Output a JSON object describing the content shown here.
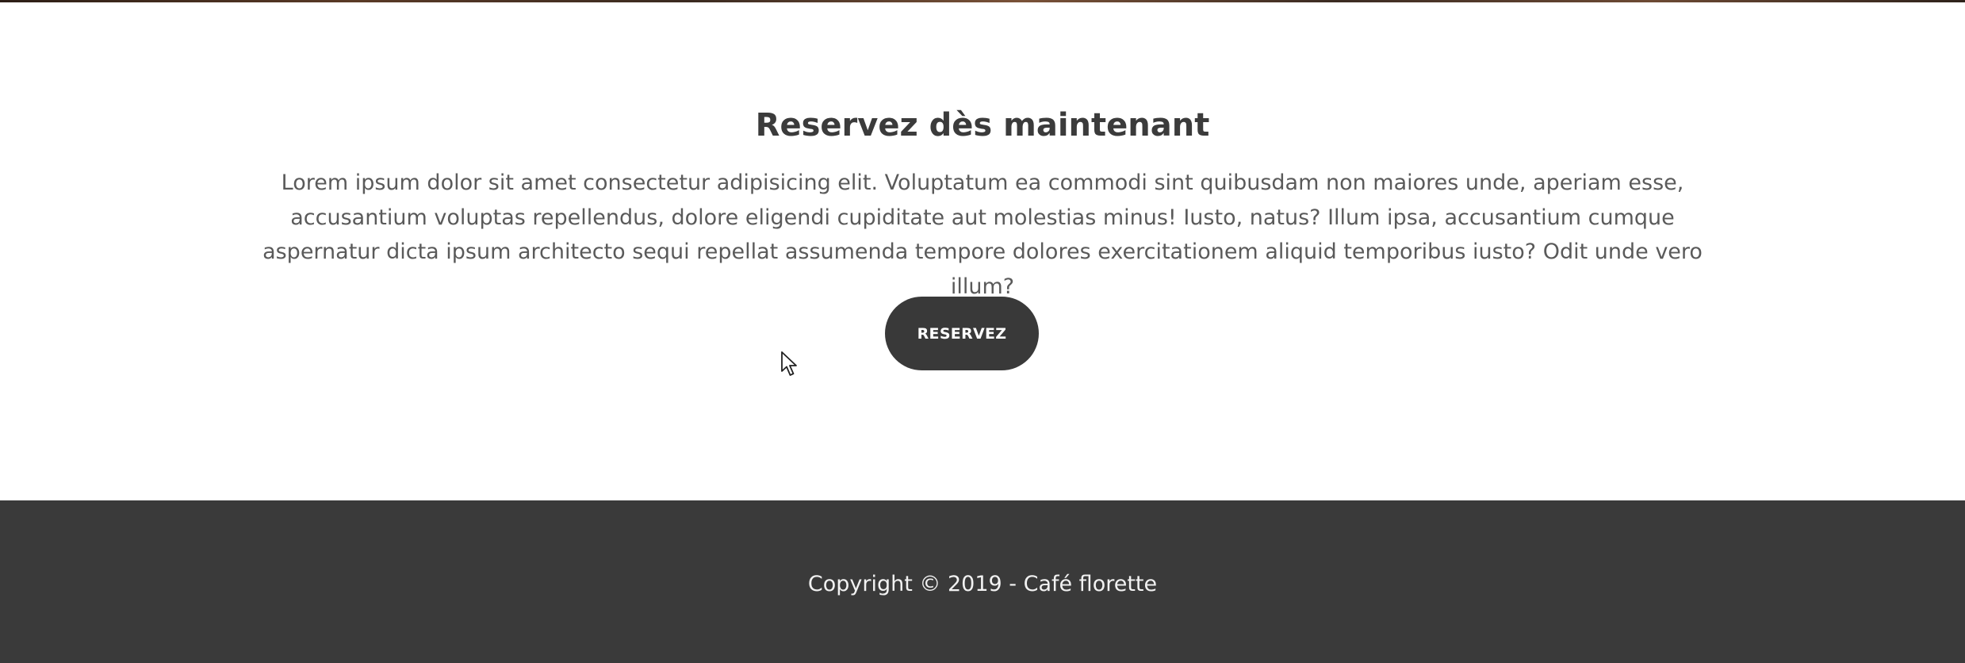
{
  "reserve_section": {
    "title": "Reservez dès maintenant",
    "text": "Lorem ipsum dolor sit amet consectetur adipisicing elit. Voluptatum ea commodi sint quibusdam non maiores unde, aperiam esse, accusantium voluptas repellendus, dolore eligendi cupiditate aut molestias minus! Iusto, natus? Illum ipsa, accusantium cumque aspernatur dicta ipsum architecto sequi repellat assumenda tempore dolores exercitationem aliquid temporibus iusto? Odit unde vero illum?",
    "button_label": "RESERVEZ"
  },
  "footer": {
    "copyright": "Copyright © 2019 - Café florette"
  },
  "cursor": {
    "icon": "mouse-pointer-icon"
  },
  "colors": {
    "button_bg": "#393939",
    "footer_bg": "#3a3a3a",
    "title_text": "#3b3b3b",
    "body_text": "#5a5a5a"
  }
}
